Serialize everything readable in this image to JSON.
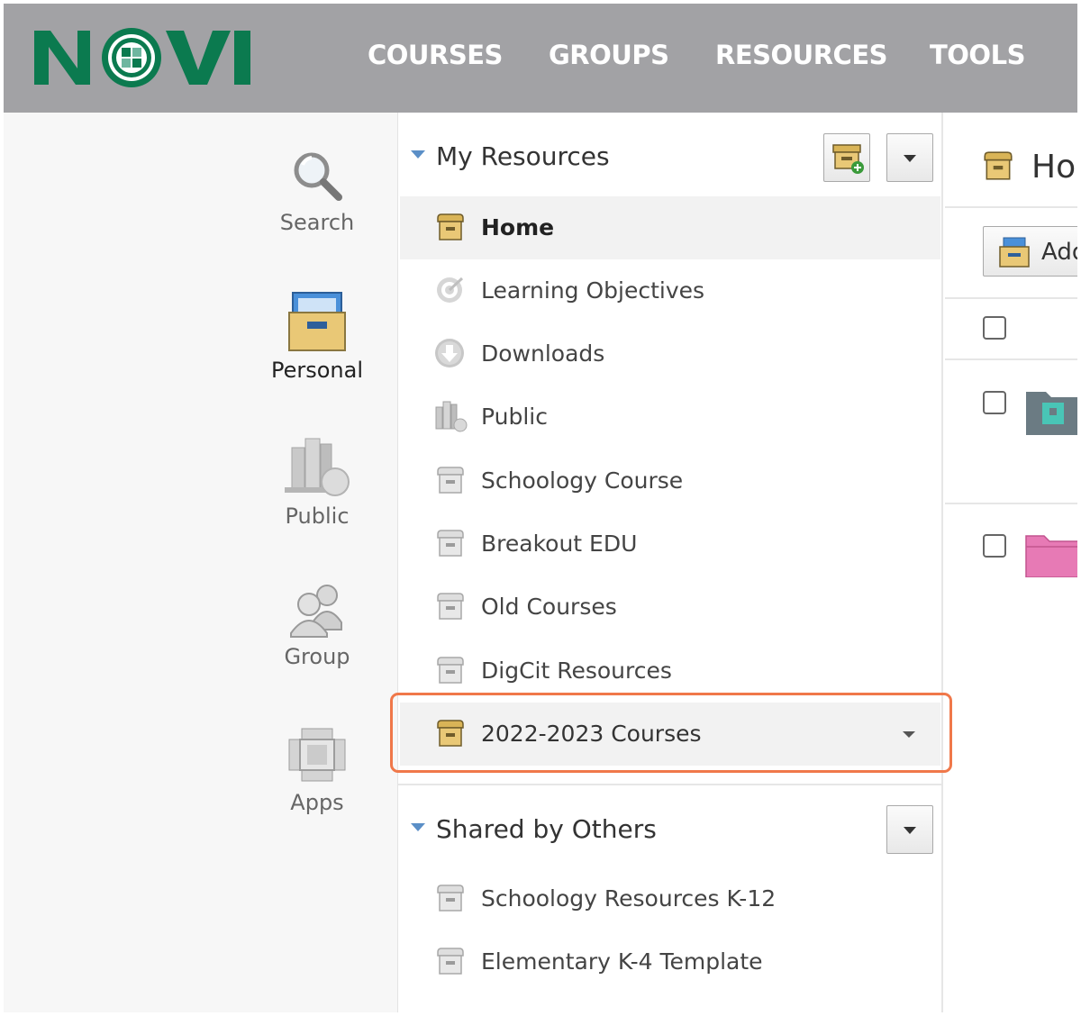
{
  "nav": {
    "items": [
      "COURSES",
      "GROUPS",
      "RESOURCES",
      "TOOLS"
    ]
  },
  "logo": {
    "text": "NOVI"
  },
  "rail": {
    "items": [
      {
        "label": "Search",
        "icon": "search-icon"
      },
      {
        "label": "Personal",
        "icon": "personal-box-icon"
      },
      {
        "label": "Public",
        "icon": "public-books-icon"
      },
      {
        "label": "Group",
        "icon": "group-people-icon"
      },
      {
        "label": "Apps",
        "icon": "apps-icon"
      }
    ]
  },
  "my_resources": {
    "title": "My Resources",
    "items": [
      {
        "label": "Home",
        "icon": "archive-box-icon"
      },
      {
        "label": "Learning Objectives",
        "icon": "target-icon"
      },
      {
        "label": "Downloads",
        "icon": "download-icon"
      },
      {
        "label": "Public",
        "icon": "public-books-icon"
      },
      {
        "label": "Schoology Course",
        "icon": "archive-box-icon"
      },
      {
        "label": "Breakout EDU",
        "icon": "archive-box-icon"
      },
      {
        "label": "Old Courses",
        "icon": "archive-box-icon"
      },
      {
        "label": "DigCit Resources",
        "icon": "archive-box-icon"
      },
      {
        "label": "2022-2023 Courses",
        "icon": "archive-box-icon"
      }
    ]
  },
  "shared": {
    "title": "Shared by Others",
    "items": [
      {
        "label": "Schoology Resources K-12",
        "icon": "archive-box-icon"
      },
      {
        "label": "Elementary K-4 Template",
        "icon": "archive-box-icon"
      }
    ]
  },
  "right_panel": {
    "title": "Ho",
    "add_label": "Add"
  },
  "colors": {
    "topbar": "#a2a2a5",
    "brand_green": "#0b7a4f",
    "highlight": "#f0784a",
    "box_gold": "#e9c876"
  }
}
